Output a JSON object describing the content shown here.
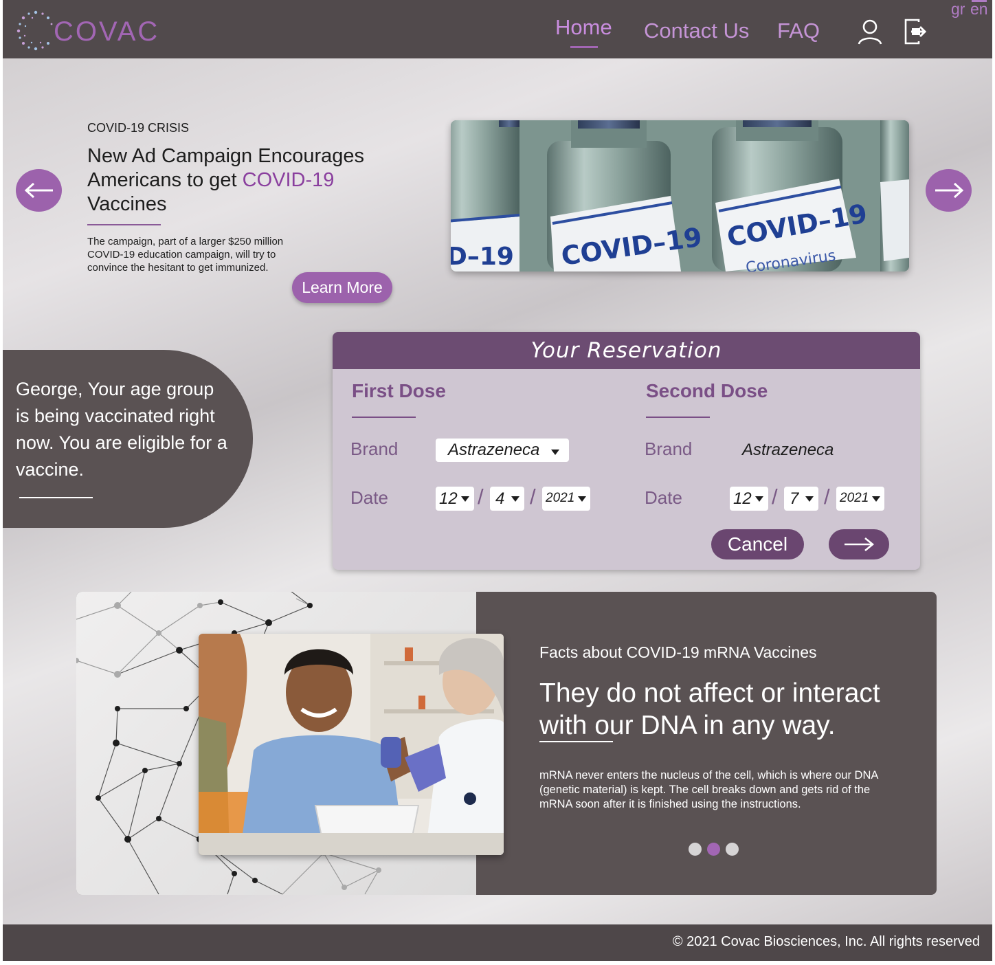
{
  "brand": {
    "name": "COVAC"
  },
  "nav": {
    "home": "Home",
    "contact": "Contact Us",
    "faq": "FAQ",
    "lang_gr": "gr",
    "lang_en": "en"
  },
  "hero": {
    "kicker": "COVID-19 CRISIS",
    "title_part1": "New Ad Campaign Encourages Americans to get ",
    "title_accent": "COVID-19",
    "title_part2": " Vaccines",
    "body": "The campaign, part of a larger $250 million COVID-19 education campaign, will try to convince the hesitant to get immunized.",
    "cta": "Learn More",
    "image": {
      "vial1": "D–19",
      "vial2": "COVID–19",
      "vial3": "COVID–19",
      "vial3_sub": "Coronavirus"
    }
  },
  "eligibility": {
    "message": "George, Your age group is being vaccinated right now. You are eligible for a vaccine."
  },
  "reservation": {
    "title": "Your Reservation",
    "first": {
      "title": "First Dose",
      "brand_label": "Brand",
      "brand": "Astrazeneca",
      "date_label": "Date",
      "day": "12",
      "month": "4",
      "year": "2021"
    },
    "second": {
      "title": "Second Dose",
      "brand_label": "Brand",
      "brand": "Astrazeneca",
      "date_label": "Date",
      "day": "12",
      "month": "7",
      "year": "2021"
    },
    "cancel": "Cancel"
  },
  "facts": {
    "kicker": "Facts about COVID-19 mRNA Vaccines",
    "title": "They do not affect or interact with our DNA in any way.",
    "body": "mRNA never enters the nucleus of the cell, which is where our DNA (genetic material) is kept. The cell breaks down and gets rid of the mRNA soon after it is finished using the instructions.",
    "carousel_active_index": 1,
    "carousel_count": 3
  },
  "footer": {
    "copyright": "© 2021 Covac Biosciences, Inc. All rights reserved"
  },
  "colors": {
    "header_bg": "#514a4c",
    "accent_purple": "#9c62ac",
    "reservation_header": "#6c4c72",
    "card_dark": "#5a5253"
  }
}
